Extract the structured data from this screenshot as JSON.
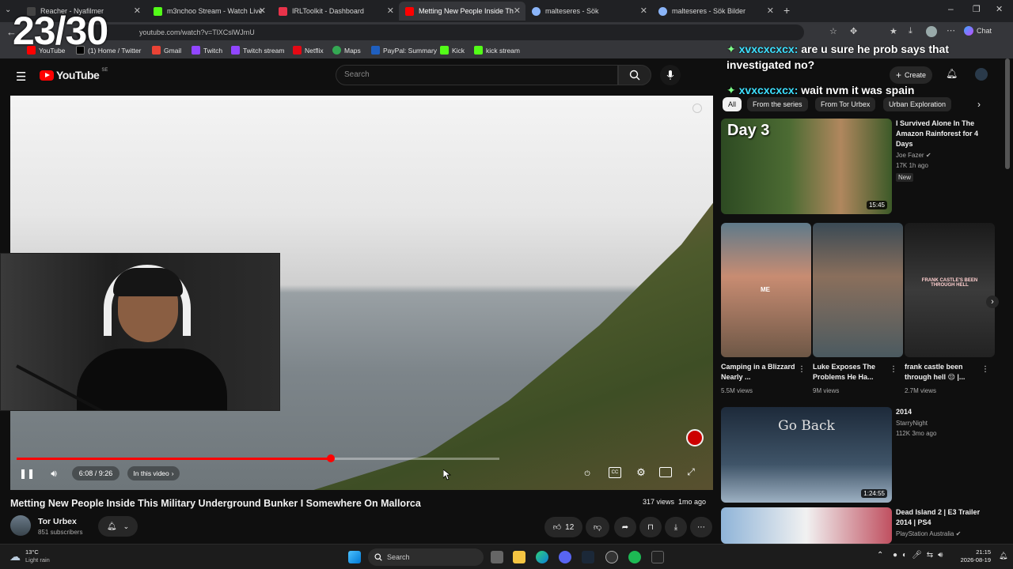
{
  "overlay": {
    "counter": "23/30"
  },
  "browser": {
    "tabs": [
      {
        "title": "Reacher - Nyafilmer",
        "color": "#444"
      },
      {
        "title": "m3nchoo Stream - Watch Live",
        "color": "#53fc18"
      },
      {
        "title": "IRLToolkit - Dashboard",
        "color": "#e8334a"
      },
      {
        "title": "Metting New People Inside Th",
        "color": "#ff0000"
      },
      {
        "title": "malteseres - Sök",
        "color": "#8ab4f8"
      },
      {
        "title": "malteseres - Sök Bilder",
        "color": "#8ab4f8"
      }
    ],
    "url": "youtube.com/watch?v=TlXCslWJmU",
    "bookmarks": [
      "YouTube",
      "(1) Home / Twitter",
      "Gmail",
      "Twitch",
      "Twitch stream",
      "Netflix",
      "Maps",
      "PayPal: Summary",
      "Kick",
      "kick stream"
    ],
    "chat_button": "Chat"
  },
  "chat_overlay": [
    {
      "user": "xvxcxcxcx:",
      "message": "are u sure he prob says that investigated no?"
    },
    {
      "user": "xvxcxcxcx:",
      "message": "wait nvm it was spain"
    }
  ],
  "youtube": {
    "logo": "YouTube",
    "region": "SE",
    "search_placeholder": "Search",
    "create_label": "Create",
    "player": {
      "current_time": "6:08",
      "duration": "9:26",
      "time_display": "6:08 / 9:26",
      "progress": 0.65,
      "in_this_video": "In this video"
    },
    "video_title": "Metting New People Inside This Military Underground Bunker I Somewhere On Mallorca",
    "views_date": "317 views  1mo ago",
    "channel": {
      "name": "Tor Urbex",
      "subscribers": "851 subscribers"
    },
    "likes": "12",
    "chips": [
      "All",
      "From the series",
      "From Tor Urbex",
      "Urban Exploration"
    ],
    "recommended": [
      {
        "title": "I Survived Alone In The Amazon Rainforest for 4 Days",
        "channel": "Joe Fazer",
        "meta": "17K  1h ago",
        "badge": "New",
        "duration": "15:45",
        "thumb_text": "Day 3"
      },
      {
        "title": "2014",
        "channel": "StarryNight",
        "meta": "112K  3mo ago",
        "duration": "1:24:55",
        "thumb_text": "Go Back"
      },
      {
        "title": "Dead Island 2 | E3 Trailer 2014 | PS4",
        "channel": "PlayStation Australia",
        "meta": ""
      }
    ],
    "shorts": [
      {
        "title": "Camping in a Blizzard Nearly ...",
        "views": "5.5M views",
        "caption": "ME"
      },
      {
        "title": "Luke Exposes The Problems He Ha...",
        "views": "9M views"
      },
      {
        "title": "frank castle been through hell 😔 |...",
        "views": "2.7M views",
        "caption": "FRANK CASTLE'S BEEN THROUGH HELL"
      }
    ]
  },
  "taskbar": {
    "weather_temp": "13°C",
    "weather_desc": "Light rain",
    "search": "Search",
    "time": "21:15",
    "date": "2026-08-19"
  }
}
